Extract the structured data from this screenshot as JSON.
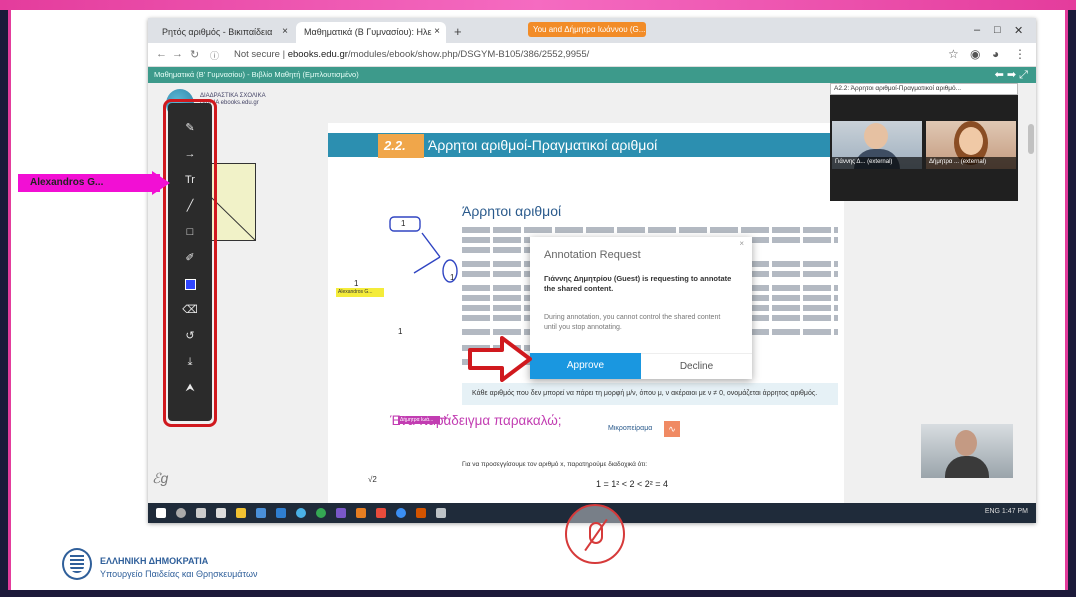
{
  "browser": {
    "tabs": [
      {
        "label": "Ρητός αριθμός - Βικιπαίδεια"
      },
      {
        "label": "Μαθηματικά (Β Γυμνασίου): Ηλε"
      }
    ],
    "share_banner": "You and Δήμητρα Ιωάννου (G...",
    "url_prefix": "Not secure",
    "url_host": "ebooks.edu.gr",
    "url_path": "/modules/ebook/show.php/DSGYM-B105/386/2552,9955/",
    "new_tab": "+",
    "window_controls": [
      "–",
      "□",
      "✕"
    ]
  },
  "ebook": {
    "bar_title": "Μαθηματικά (Β' Γυμνασίου) - Βιβλίο Μαθητή (Εμπλουτισμένο)",
    "logo_text": "ΔΙΑΔΡΑΣΤΙΚΑ ΣΧΟΛΙΚΑ ΒΙΒΛΙΑ ebooks.edu.gr",
    "section_badge": "2.2.",
    "section_heading": "Άρρητοι αριθμοί-Πραγματικοί αριθμοί",
    "section_title": "Άρρητοι αριθμοί",
    "definition": "Κάθε αριθμός που δεν μπορεί να πάρει τη μορφή μ/ν, όπου μ, ν ακέραιοι με ν ≠ 0, ονομάζεται άρρητος αριθμός.",
    "example_title": "Ένα παράδειγμα παρακαλώ;",
    "macro_label": "Μικροπείραμα",
    "approx_text": "Για να προσεγγίσουμε τον αριθμό x, παρατηρούμε διαδοχικά ότι:",
    "inequality": "1 = 1²  <  2  <   2² = 4",
    "sqrt_label": "√2",
    "square_labels": {
      "top": "1",
      "left": "1",
      "bottom": "1",
      "right": "1"
    },
    "yellow_tag": "Alexandros G...",
    "purple_tag": "Δήμητρα Ιωά..."
  },
  "annotation_toolbar": {
    "tools": [
      "pen-tool",
      "arrow-tool",
      "text-tool",
      "line-tool",
      "shape-tool",
      "highlighter-tool",
      "color-tool",
      "eraser-tool",
      "undo-tool",
      "save-tool",
      "pointer-tool"
    ],
    "text_glyph": "Tr",
    "accent_color": "#3046ff"
  },
  "participants": {
    "select": "Α2.2: Άρρητοι αριθμοί-Πραγματικοί αριθμό...",
    "people": [
      {
        "name": "Γιάννης Δ... (external)"
      },
      {
        "name": "Δήμητρα ... (external)"
      }
    ]
  },
  "dialog": {
    "title": "Annotation Request",
    "close": "×",
    "message": "Γιάννης Δημητρίου (Guest) is requesting to annotate the shared content.",
    "note": "During annotation, you cannot control the shared content until you stop annotating.",
    "approve": "Approve",
    "decline": "Decline"
  },
  "taskbar": {
    "tray": "ENG  1:47 PM"
  },
  "callout": {
    "name": "Alexandros G..."
  },
  "ministry": {
    "title": "ΕΛΛΗΝΙΚΗ ΔΗΜΟΚΡΑΤΙΑ",
    "subtitle": "Υπουργείο Παιδείας και Θρησκευμάτων"
  },
  "colors": {
    "accent_pink": "#e43c9c",
    "callout_magenta": "#f20fd4",
    "approve_blue": "#1a97e0",
    "highlight_red": "#d0191e",
    "ebook_teal": "#3d9a8b"
  }
}
